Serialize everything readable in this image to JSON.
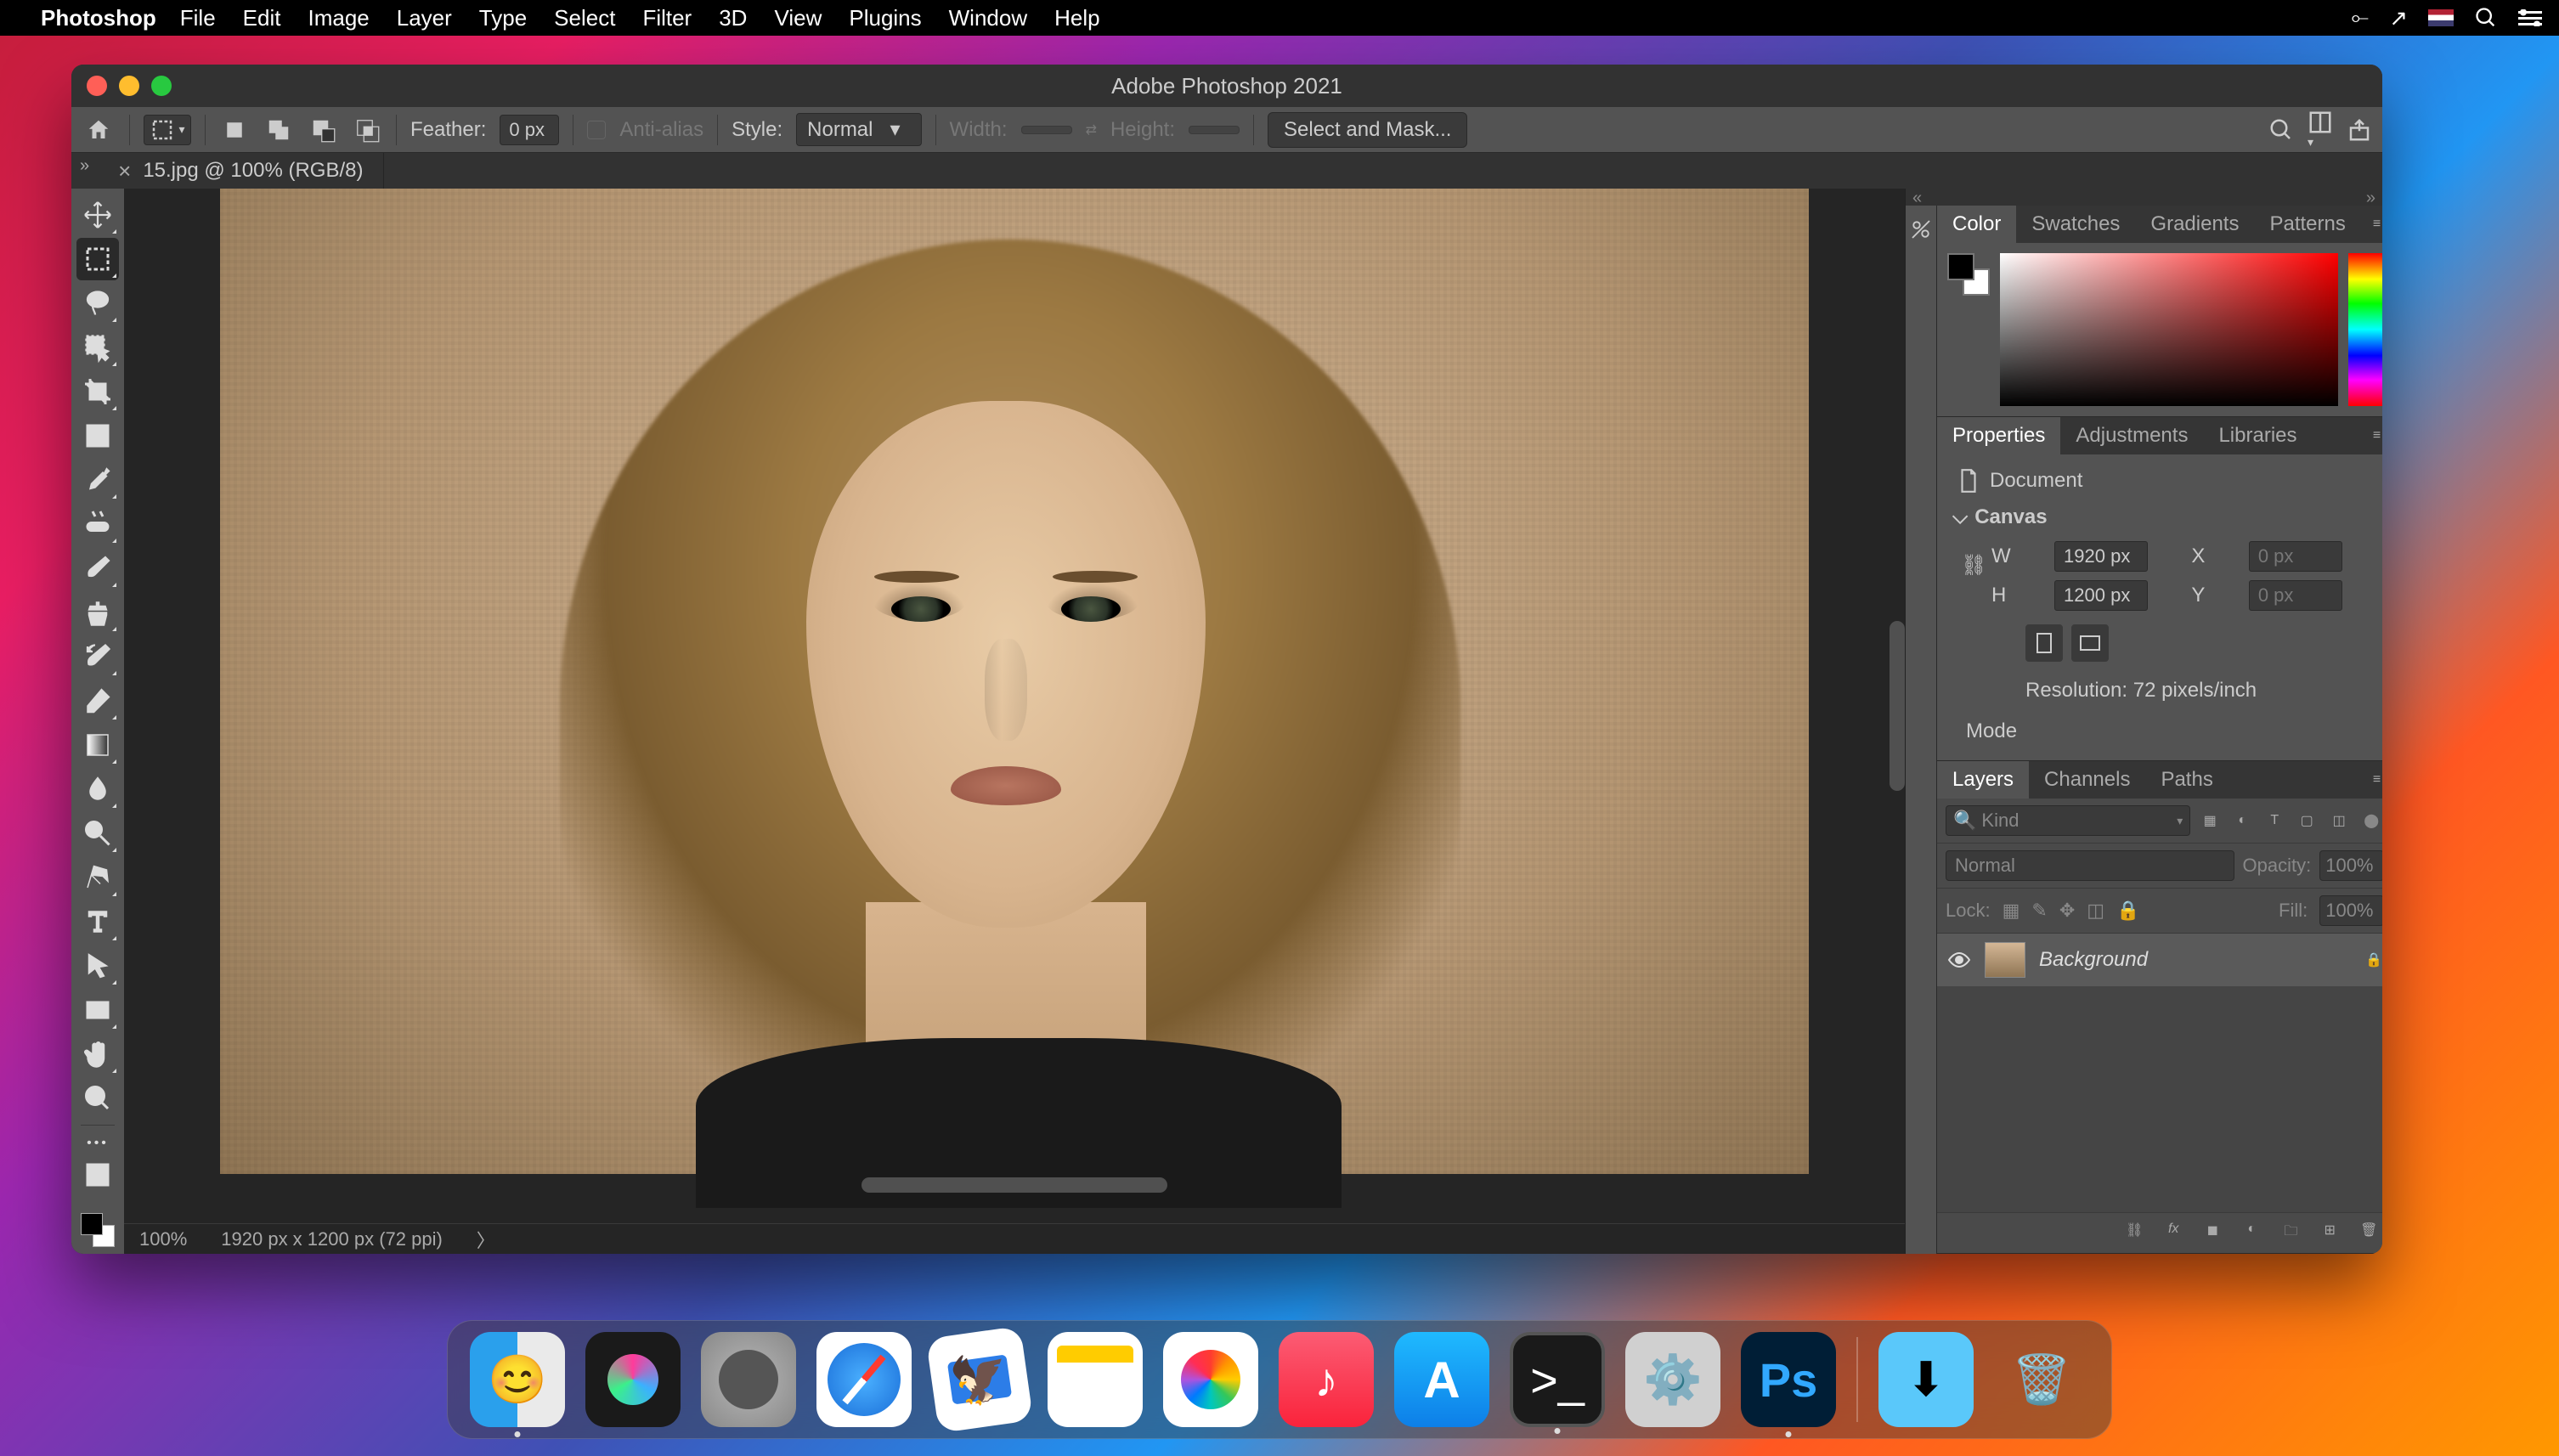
{
  "macos_menu": {
    "app_name": "Photoshop",
    "items": [
      "File",
      "Edit",
      "Image",
      "Layer",
      "Type",
      "Select",
      "Filter",
      "3D",
      "View",
      "Plugins",
      "Window",
      "Help"
    ]
  },
  "window": {
    "title": "Adobe Photoshop 2021"
  },
  "options_bar": {
    "feather_label": "Feather:",
    "feather_value": "0 px",
    "anti_alias_label": "Anti-alias",
    "style_label": "Style:",
    "style_value": "Normal",
    "width_label": "Width:",
    "width_value": "",
    "height_label": "Height:",
    "height_value": "",
    "select_mask_btn": "Select and Mask..."
  },
  "document_tab": {
    "title": "15.jpg @ 100% (RGB/8)"
  },
  "status_bar": {
    "zoom": "100%",
    "doc_info": "1920 px x 1200 px (72 ppi)"
  },
  "panels": {
    "color_tabs": [
      "Color",
      "Swatches",
      "Gradients",
      "Patterns"
    ],
    "properties_tabs": [
      "Properties",
      "Adjustments",
      "Libraries"
    ],
    "layers_tabs": [
      "Layers",
      "Channels",
      "Paths"
    ]
  },
  "properties": {
    "header": "Document",
    "canvas_section": "Canvas",
    "w_label": "W",
    "w_value": "1920 px",
    "h_label": "H",
    "h_value": "1200 px",
    "x_label": "X",
    "x_value": "0 px",
    "y_label": "Y",
    "y_value": "0 px",
    "resolution": "Resolution: 72 pixels/inch",
    "mode_label": "Mode"
  },
  "layers": {
    "kind_placeholder": "Kind",
    "blend_mode": "Normal",
    "opacity_label": "Opacity:",
    "opacity_value": "100%",
    "lock_label": "Lock:",
    "fill_label": "Fill:",
    "fill_value": "100%",
    "layer_name": "Background"
  },
  "dock_apps": [
    "Finder",
    "Siri",
    "Launchpad",
    "Safari",
    "Mail",
    "Notes",
    "Photos",
    "Music",
    "App Store",
    "Terminal",
    "System Preferences",
    "Photoshop",
    "Downloads",
    "Trash"
  ]
}
